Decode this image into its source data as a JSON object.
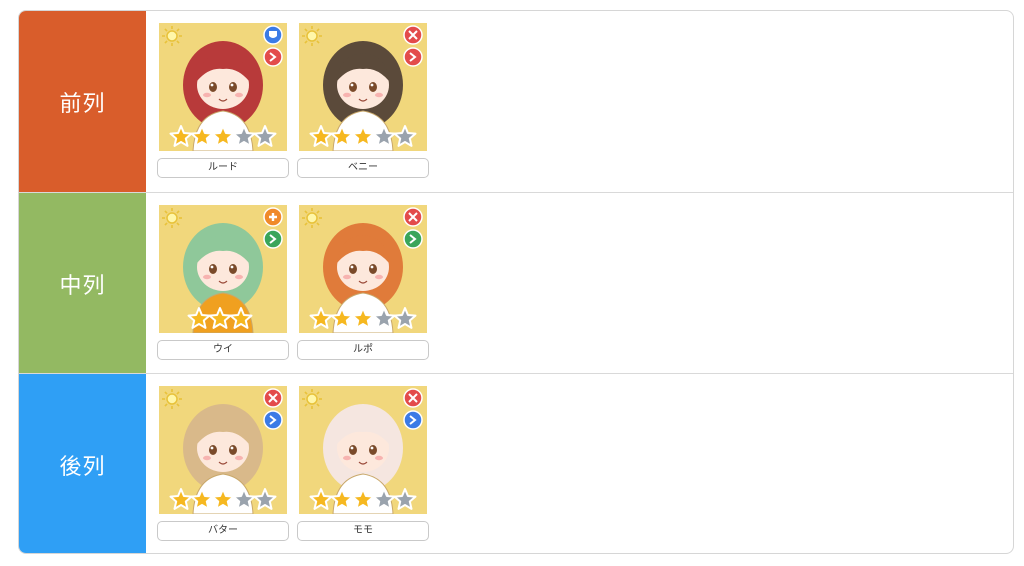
{
  "rows": [
    {
      "label": "前列",
      "color": "#d95d2b",
      "characters": [
        {
          "name": "ルード",
          "stars": 3,
          "max_stars": 5,
          "badges": [
            "shield",
            "arrow"
          ],
          "badge_colors": [
            "#3b7be6",
            "#e34b4b"
          ],
          "hair": "#b83a3a",
          "accent": "#ffffff"
        },
        {
          "name": "ベニー",
          "stars": 3,
          "max_stars": 5,
          "badges": [
            "tools",
            "arrow"
          ],
          "badge_colors": [
            "#e34b4b",
            "#e34b4b"
          ],
          "hair": "#5b4a3a",
          "accent": "#ffffff"
        }
      ]
    },
    {
      "label": "中列",
      "color": "#93b962",
      "characters": [
        {
          "name": "ウイ",
          "stars": 3,
          "max_stars": 3,
          "badges": [
            "plus",
            "arrow"
          ],
          "badge_colors": [
            "#f08a2a",
            "#3aa55a"
          ],
          "hair": "#8fc89a",
          "accent": "#f0a020"
        },
        {
          "name": "ルポ",
          "stars": 3,
          "max_stars": 5,
          "badges": [
            "tools",
            "arrow"
          ],
          "badge_colors": [
            "#e34b4b",
            "#3aa55a"
          ],
          "hair": "#e07b3a",
          "accent": "#ffffff"
        }
      ]
    },
    {
      "label": "後列",
      "color": "#2f9ff5",
      "characters": [
        {
          "name": "バター",
          "stars": 3,
          "max_stars": 5,
          "badges": [
            "tools",
            "arrow"
          ],
          "badge_colors": [
            "#e34b4b",
            "#3b7be6"
          ],
          "hair": "#d9b98a",
          "accent": "#ffffff"
        },
        {
          "name": "モモ",
          "stars": 3,
          "max_stars": 5,
          "badges": [
            "tools",
            "arrow"
          ],
          "badge_colors": [
            "#e34b4b",
            "#3b7be6"
          ],
          "hair": "#f5e6e0",
          "accent": "#ffffff"
        }
      ]
    }
  ]
}
